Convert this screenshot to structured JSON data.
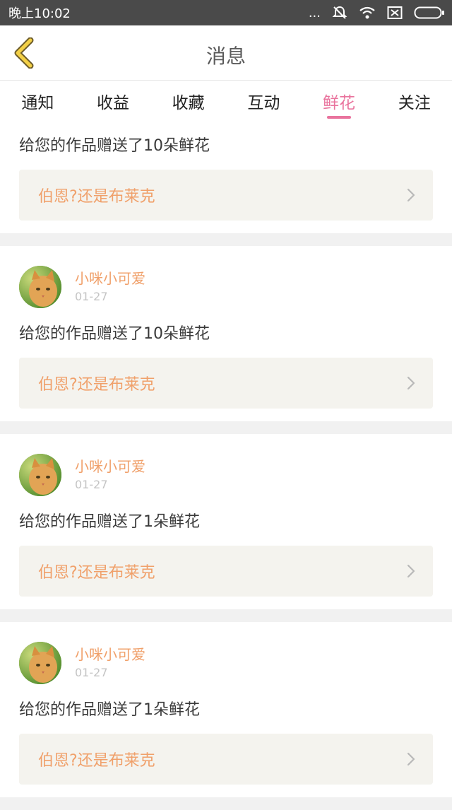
{
  "status_bar": {
    "time": "晚上10:02",
    "dots": "..."
  },
  "header": {
    "title": "消息"
  },
  "tabs": [
    {
      "label": "通知"
    },
    {
      "label": "收益"
    },
    {
      "label": "收藏"
    },
    {
      "label": "互动"
    },
    {
      "label": "鲜花"
    },
    {
      "label": "关注"
    }
  ],
  "active_tab": "鲜花",
  "messages": [
    {
      "text": "给您的作品赠送了10朵鲜花",
      "work_title": "伯恩?还是布莱克"
    },
    {
      "username": "小咪小可爱",
      "date": "01-27",
      "text": "给您的作品赠送了10朵鲜花",
      "work_title": "伯恩?还是布莱克"
    },
    {
      "username": "小咪小可爱",
      "date": "01-27",
      "text": "给您的作品赠送了1朵鲜花",
      "work_title": "伯恩?还是布莱克"
    },
    {
      "username": "小咪小可爱",
      "date": "01-27",
      "text": "给您的作品赠送了1朵鲜花",
      "work_title": "伯恩?还是布莱克"
    }
  ],
  "colors": {
    "accent": "#e9739d",
    "username": "#f0a06a",
    "back_arrow": "#f3d046",
    "link_bg": "#f4f3ee"
  }
}
